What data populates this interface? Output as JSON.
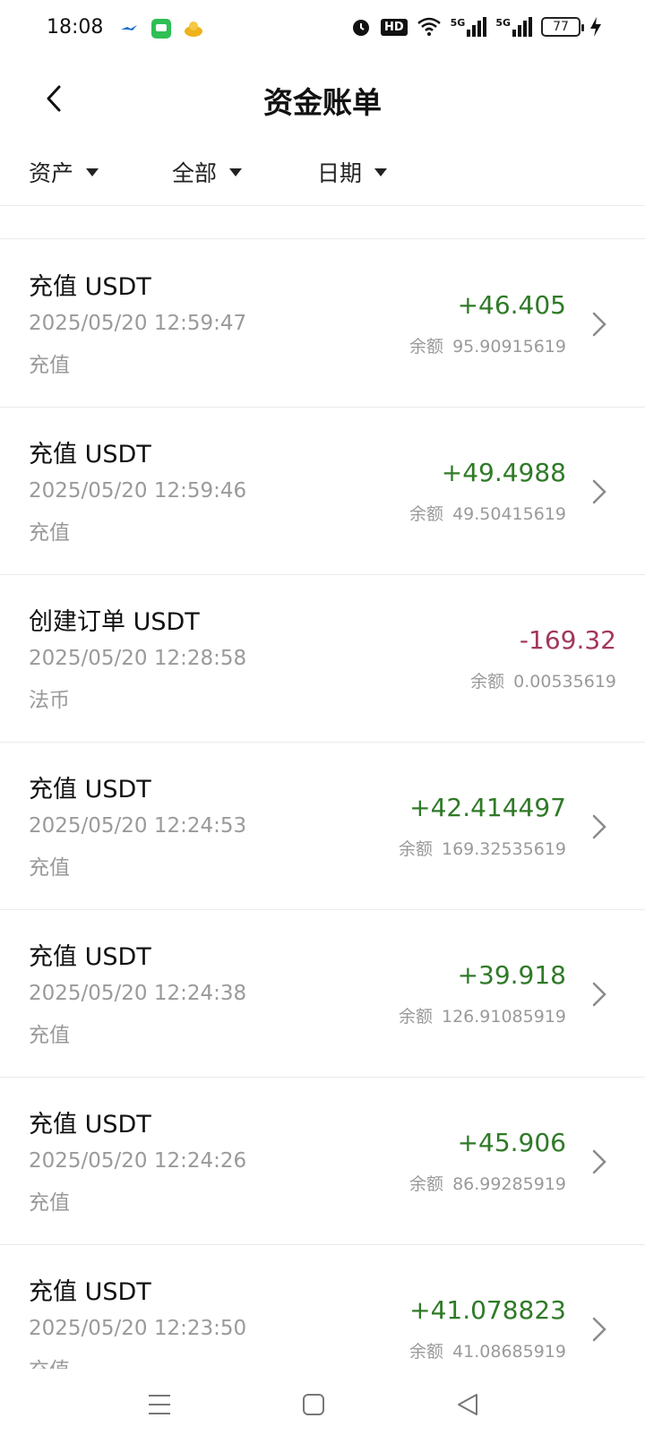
{
  "status": {
    "time": "18:08",
    "battery": "77",
    "hd_label": "HD",
    "net1": "5G",
    "net2": "5G"
  },
  "header": {
    "title": "资金账单"
  },
  "filters": [
    {
      "label": "资产"
    },
    {
      "label": "全部"
    },
    {
      "label": "日期"
    }
  ],
  "records": [
    {
      "title": "充值 USDT",
      "time": "2025/05/20 12:59:47",
      "type": "充值",
      "amount": "+46.405",
      "balance_label": "余额",
      "balance": "95.90915619"
    },
    {
      "title": "充值 USDT",
      "time": "2025/05/20 12:59:46",
      "type": "充值",
      "amount": "+49.4988",
      "balance_label": "余额",
      "balance": "49.50415619"
    },
    {
      "title": "创建订单 USDT",
      "time": "2025/05/20 12:28:58",
      "type": "法币",
      "amount": "-169.32",
      "balance_label": "余额",
      "balance": "0.00535619"
    },
    {
      "title": "充值 USDT",
      "time": "2025/05/20 12:24:53",
      "type": "充值",
      "amount": "+42.414497",
      "balance_label": "余额",
      "balance": "169.32535619"
    },
    {
      "title": "充值 USDT",
      "time": "2025/05/20 12:24:38",
      "type": "充值",
      "amount": "+39.918",
      "balance_label": "余额",
      "balance": "126.91085919"
    },
    {
      "title": "充值 USDT",
      "time": "2025/05/20 12:24:26",
      "type": "充值",
      "amount": "+45.906",
      "balance_label": "余额",
      "balance": "86.99285919"
    },
    {
      "title": "充值 USDT",
      "time": "2025/05/20 12:23:50",
      "type": "充值",
      "amount": "+41.078823",
      "balance_label": "余额",
      "balance": "41.08685919"
    }
  ],
  "colors": {
    "positive": "#2f7a27",
    "negative": "#a2385c",
    "muted": "#9a9a9a"
  },
  "icons": [
    "back-arrow-icon",
    "dropdown-triangle-icon",
    "chevron-right-icon",
    "alarm-icon",
    "wifi-icon",
    "signal-icon",
    "battery-icon",
    "charging-icon",
    "menu-icon",
    "home-square-icon",
    "back-triangle-icon"
  ]
}
